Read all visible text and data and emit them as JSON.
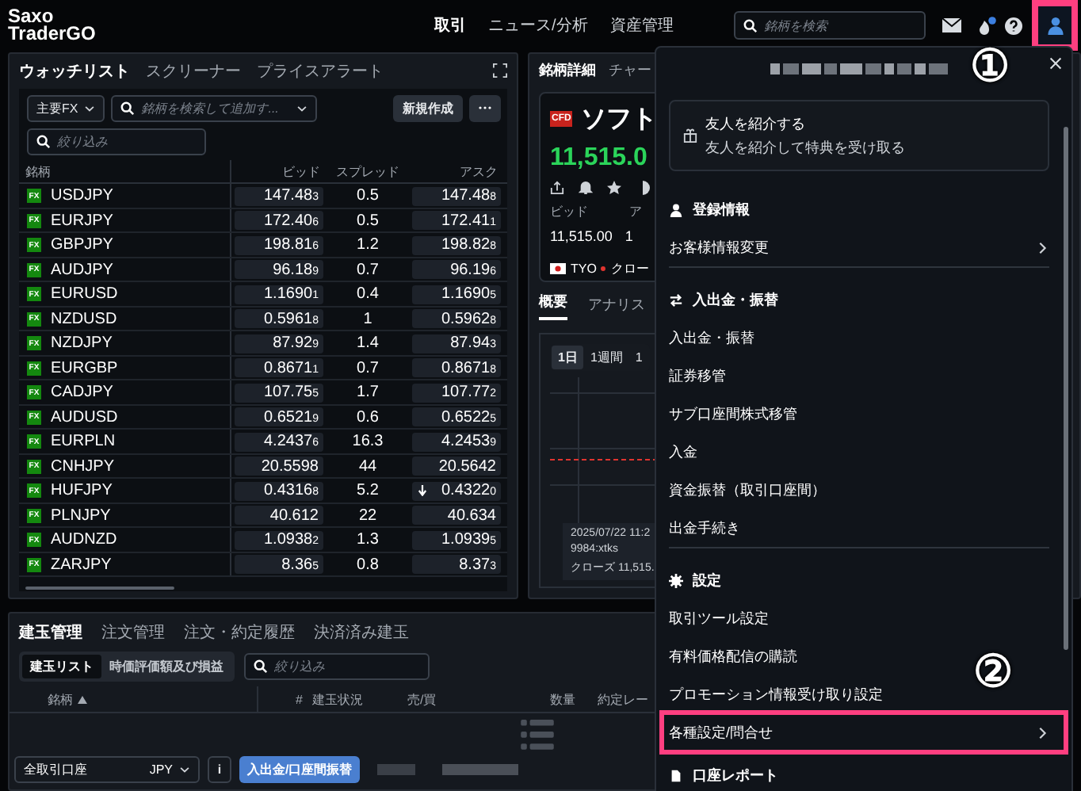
{
  "app": {
    "logo": [
      "Saxo",
      "TraderGO"
    ]
  },
  "nav": [
    {
      "label": "取引",
      "selected": true
    },
    {
      "label": "ニュース/分析",
      "selected": false
    },
    {
      "label": "資産管理",
      "selected": false
    }
  ],
  "global_search": {
    "placeholder": "銘柄を検索"
  },
  "notifications": {
    "unread": true
  },
  "account_button": {
    "highlighted": true
  },
  "watchlist": {
    "tabs": [
      {
        "label": "ウォッチリスト",
        "selected": true
      },
      {
        "label": "スクリーナー",
        "selected": false
      },
      {
        "label": "プライスアラート",
        "selected": false
      }
    ],
    "list_select": "主要FX",
    "search": {
      "placeholder": "銘柄を検索して追加す..."
    },
    "new_button": "新規作成",
    "filter": {
      "placeholder": "絞り込み"
    },
    "columns": [
      "銘柄",
      "ビッド",
      "スプレッド",
      "アスク"
    ],
    "rows": [
      {
        "badge": "FX",
        "name": "USDJPY",
        "bid": "147.48",
        "bid_pip": "3",
        "spread": "0.5",
        "ask": "147.48",
        "ask_pip": "8",
        "ask_down": false
      },
      {
        "badge": "FX",
        "name": "EURJPY",
        "bid": "172.40",
        "bid_pip": "6",
        "spread": "0.5",
        "ask": "172.41",
        "ask_pip": "1",
        "ask_down": false
      },
      {
        "badge": "FX",
        "name": "GBPJPY",
        "bid": "198.81",
        "bid_pip": "6",
        "spread": "1.2",
        "ask": "198.82",
        "ask_pip": "8",
        "ask_down": false
      },
      {
        "badge": "FX",
        "name": "AUDJPY",
        "bid": "96.18",
        "bid_pip": "9",
        "spread": "0.7",
        "ask": "96.19",
        "ask_pip": "6",
        "ask_down": false
      },
      {
        "badge": "FX",
        "name": "EURUSD",
        "bid": "1.1690",
        "bid_pip": "1",
        "spread": "0.4",
        "ask": "1.1690",
        "ask_pip": "5",
        "ask_down": false
      },
      {
        "badge": "FX",
        "name": "NZDUSD",
        "bid": "0.5961",
        "bid_pip": "8",
        "spread": "1",
        "ask": "0.5962",
        "ask_pip": "8",
        "ask_down": false
      },
      {
        "badge": "FX",
        "name": "NZDJPY",
        "bid": "87.92",
        "bid_pip": "9",
        "spread": "1.4",
        "ask": "87.94",
        "ask_pip": "3",
        "ask_down": false
      },
      {
        "badge": "FX",
        "name": "EURGBP",
        "bid": "0.8671",
        "bid_pip": "1",
        "spread": "0.7",
        "ask": "0.8671",
        "ask_pip": "8",
        "ask_down": false
      },
      {
        "badge": "FX",
        "name": "CADJPY",
        "bid": "107.75",
        "bid_pip": "5",
        "spread": "1.7",
        "ask": "107.77",
        "ask_pip": "2",
        "ask_down": false
      },
      {
        "badge": "FX",
        "name": "AUDUSD",
        "bid": "0.6521",
        "bid_pip": "9",
        "spread": "0.6",
        "ask": "0.6522",
        "ask_pip": "5",
        "ask_down": false
      },
      {
        "badge": "FX",
        "name": "EURPLN",
        "bid": "4.2437",
        "bid_pip": "6",
        "spread": "16.3",
        "ask": "4.2453",
        "ask_pip": "9",
        "ask_down": false
      },
      {
        "badge": "FX",
        "name": "CNHJPY",
        "bid": "20.5598",
        "spread": "44",
        "ask": "20.5642",
        "ask_down": false
      },
      {
        "badge": "FX",
        "name": "HUFJPY",
        "bid": "0.4316",
        "bid_pip": "8",
        "spread": "5.2",
        "ask": "0.4322",
        "ask_pip": "0",
        "ask_down": true
      },
      {
        "badge": "FX",
        "name": "PLNJPY",
        "bid": "40.612",
        "spread": "22",
        "ask": "40.634",
        "ask_down": false
      },
      {
        "badge": "FX",
        "name": "AUDNZD",
        "bid": "1.0938",
        "bid_pip": "2",
        "spread": "1.3",
        "ask": "1.0939",
        "ask_pip": "5",
        "ask_down": false
      },
      {
        "badge": "FX",
        "name": "ZARJPY",
        "bid": "8.36",
        "bid_pip": "5",
        "spread": "0.8",
        "ask": "8.37",
        "ask_pip": "3",
        "ask_down": false
      }
    ]
  },
  "detail": {
    "tabs": [
      {
        "label": "銘柄詳細",
        "selected": true
      },
      {
        "label": "チャー",
        "selected": false
      }
    ],
    "badge": "CFD",
    "name": "ソフト",
    "price": "11,515.0",
    "bid_label": "ビッド",
    "ask_label": "ア",
    "bid": "11,515.00",
    "ask": "1",
    "exchange": "TYO",
    "status": "クロー",
    "sub_tabs": [
      {
        "label": "概要",
        "selected": true
      },
      {
        "label": "アナリス",
        "selected": false
      }
    ],
    "ranges": [
      {
        "label": "1日",
        "selected": true
      },
      {
        "label": "1週間",
        "selected": false
      },
      {
        "label": "1",
        "selected": false
      }
    ],
    "tooltip": [
      "2025/07/22 11:2",
      "9984:xtks",
      "クローズ 11,515."
    ]
  },
  "positions": {
    "tabs": [
      {
        "label": "建玉管理",
        "selected": true
      },
      {
        "label": "注文管理",
        "selected": false
      },
      {
        "label": "注文・約定履歴",
        "selected": false
      },
      {
        "label": "決済済み建玉",
        "selected": false
      }
    ],
    "views": [
      {
        "label": "建玉リスト",
        "selected": true
      },
      {
        "label": "時価評価額及び損益",
        "selected": false
      }
    ],
    "filter": {
      "placeholder": "絞り込み"
    },
    "columns": [
      {
        "label": "銘柄",
        "sorted": true
      },
      {
        "label": "#"
      },
      {
        "label": "建玉状況"
      },
      {
        "label": "売/買"
      },
      {
        "label": "数量"
      },
      {
        "label": "約定レー"
      }
    ],
    "account": "全取引口座",
    "currency": "JPY",
    "info_button": "i",
    "transfer_button": "入出金/口座間振替"
  },
  "account_menu": {
    "refer": {
      "title": "友人を紹介する",
      "subtitle": "友人を紹介して特典を受け取る"
    },
    "sections": [
      {
        "title": "登録情報",
        "items": [
          {
            "label": "お客様情報変更",
            "submenu": true,
            "highlighted": false
          }
        ]
      },
      {
        "title": "入出金・振替",
        "items": [
          {
            "label": "入出金・振替",
            "submenu": false,
            "highlighted": false
          },
          {
            "label": "証券移管",
            "submenu": false,
            "highlighted": false
          },
          {
            "label": "サブ口座間株式移管",
            "submenu": false,
            "highlighted": false
          },
          {
            "label": "入金",
            "submenu": false,
            "highlighted": false
          },
          {
            "label": "資金振替（取引口座間）",
            "submenu": false,
            "highlighted": false
          },
          {
            "label": "出金手続き",
            "submenu": false,
            "highlighted": false
          }
        ]
      },
      {
        "title": "設定",
        "items": [
          {
            "label": "取引ツール設定",
            "submenu": false,
            "highlighted": false
          },
          {
            "label": "有料価格配信の購読",
            "submenu": false,
            "highlighted": false
          },
          {
            "label": "プロモーション情報受け取り設定",
            "submenu": false,
            "highlighted": false
          },
          {
            "label": "各種設定/問合せ",
            "submenu": true,
            "highlighted": true
          }
        ]
      },
      {
        "title": "口座レポート"
      }
    ]
  },
  "annotations": [
    {
      "label": "①"
    },
    {
      "label": "②"
    }
  ]
}
